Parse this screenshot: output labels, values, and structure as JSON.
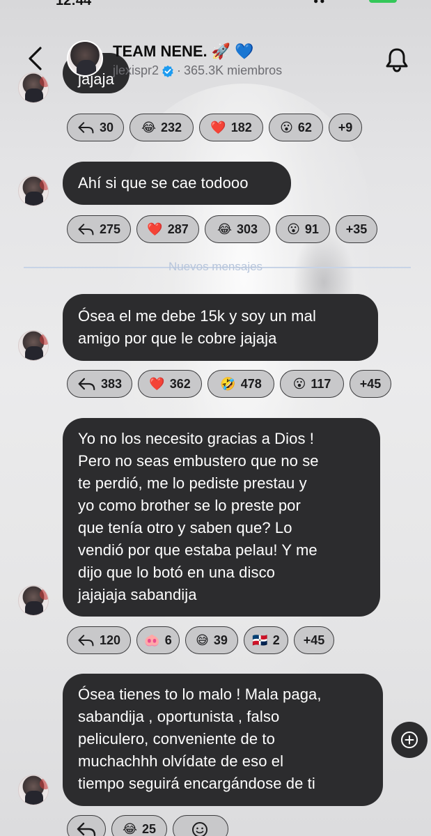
{
  "status_bar": {
    "time": "12:44"
  },
  "header": {
    "title": "TEAM NENE. 🚀 💙",
    "handle": "jlexispr2",
    "separator": "·",
    "members": "365.3K miembros"
  },
  "divider": {
    "label": "Nuevos mensajes"
  },
  "messages": [
    {
      "lines": [
        "jajaja"
      ],
      "reactions": [
        {
          "icon": "reply-icon",
          "count": "30"
        },
        {
          "emoji": "😂",
          "count": "232"
        },
        {
          "emoji": "❤️",
          "count": "182"
        },
        {
          "emoji": "😮",
          "count": "62"
        },
        {
          "count": "+9"
        }
      ]
    },
    {
      "lines": [
        "Ahí si que se cae todooo"
      ],
      "reactions": [
        {
          "icon": "reply-icon",
          "count": "275"
        },
        {
          "emoji": "❤️",
          "count": "287"
        },
        {
          "emoji": "😂",
          "count": "303"
        },
        {
          "emoji": "😮",
          "count": "91"
        },
        {
          "count": "+35"
        }
      ]
    },
    {
      "lines": [
        "Ósea el  me debe 15k y soy un mal",
        "amigo por que le cobre jajaja"
      ],
      "reactions": [
        {
          "icon": "reply-icon",
          "count": "383"
        },
        {
          "emoji": "❤️",
          "count": "362"
        },
        {
          "emoji": "🤣",
          "count": "478"
        },
        {
          "emoji": "😮",
          "count": "117"
        },
        {
          "count": "+45"
        }
      ]
    },
    {
      "lines": [
        "Yo no los necesito gracias a Dios !",
        "Pero no seas embustero que no se",
        "te perdió, me lo pediste prestau y",
        "yo como brother se lo preste por",
        "que tenía otro y saben que? Lo",
        "vendió por que estaba pelau! Y me",
        "dijo que lo botó en una disco",
        "jajajaja sabandija"
      ],
      "reactions": [
        {
          "icon": "reply-icon",
          "count": "120"
        },
        {
          "emoji": "🐽",
          "count": "6"
        },
        {
          "emoji": "😅",
          "count": "39"
        },
        {
          "emoji": "🇩🇴",
          "count": "2"
        },
        {
          "count": "+45"
        }
      ]
    },
    {
      "lines": [
        "Ósea tienes to lo malo ! Mala paga,",
        "sabandija , oportunista , falso",
        "peliculero, conveniente de to",
        "muchachhh olvídate de eso el",
        "tiempo seguirá encargándose de ti"
      ],
      "reactions": [
        {
          "icon": "reply-icon",
          "count": ""
        },
        {
          "emoji": "😂",
          "count": "25"
        },
        {
          "icon": "add-reaction-icon",
          "count": ""
        }
      ]
    }
  ]
}
